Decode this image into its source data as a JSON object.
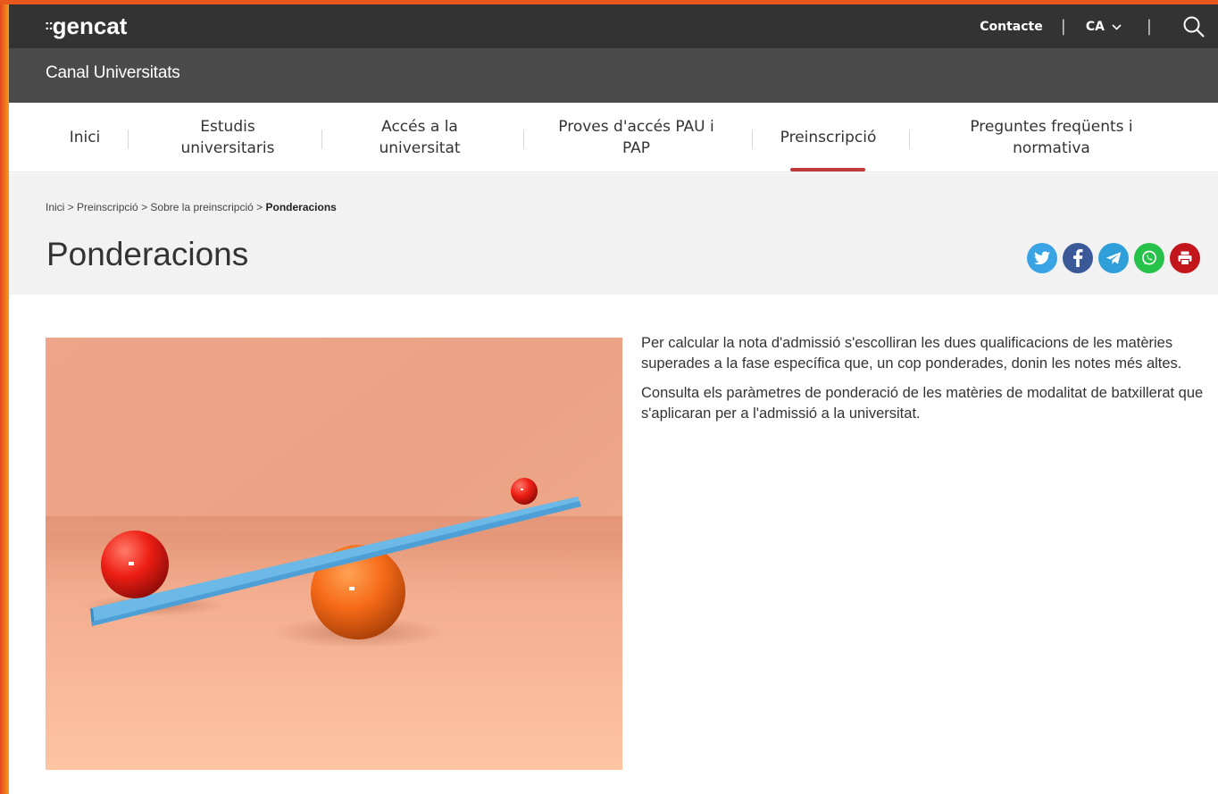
{
  "brand": {
    "logo_text": "gencat",
    "logo_dots": "::"
  },
  "topbar": {
    "contacte": "Contacte",
    "separator": "|",
    "language": "CA",
    "icons": {
      "search": "search-icon",
      "language_chevron": "chevron-down-icon"
    }
  },
  "channel": {
    "title": "Canal Universitats"
  },
  "nav": {
    "items": [
      {
        "label": "Inici"
      },
      {
        "label": "Estudis\nuniversitaris"
      },
      {
        "label": "Accés a la\nuniversitat"
      },
      {
        "label": "Proves d'accés PAU i\nPAP"
      },
      {
        "label": "Preinscripció",
        "active": true
      },
      {
        "label": "Preguntes freqüents i\nnormativa"
      }
    ],
    "active_color": "#c0393b"
  },
  "breadcrumb": {
    "items": [
      "Inici",
      "Preinscripció",
      "Sobre la preinscripció"
    ],
    "current": "Ponderacions",
    "separator": " > "
  },
  "page": {
    "title": "Ponderacions"
  },
  "share": {
    "icons": [
      {
        "name": "twitter-icon",
        "color": "#3aa3e3"
      },
      {
        "name": "facebook-icon",
        "color": "#3b5998"
      },
      {
        "name": "telegram-icon",
        "color": "#2f9fd9"
      },
      {
        "name": "whatsapp-icon",
        "color": "#26c24a"
      },
      {
        "name": "print-icon",
        "color": "#c3161c"
      }
    ]
  },
  "content": {
    "paragraphs": [
      "Per calcular la nota d'admissió s'escolliran les dues qualificacions de les matèries superades a la fase específica que, un cop ponderades, donin les notes més altes.",
      "Consulta els paràmetres de ponderació de les matèries de modalitat de batxillerat que s'aplicaran per a l'admissió a la universitat."
    ]
  },
  "colors": {
    "topbar": "#333333",
    "channel_bar": "#4a4a4a",
    "header_bg": "#f2f2f2",
    "frame": "#f7a21b"
  }
}
